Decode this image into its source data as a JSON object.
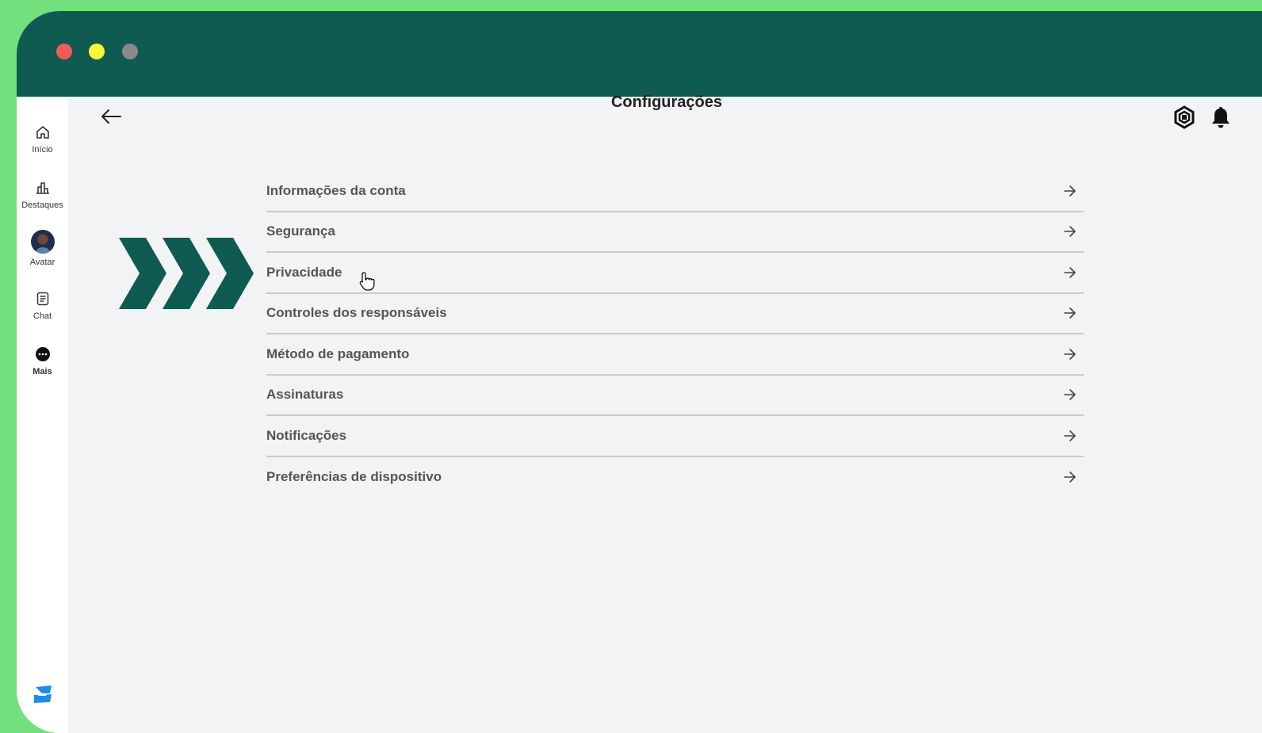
{
  "window": {
    "controls": [
      "close",
      "minimize",
      "maximize"
    ]
  },
  "sidebar": {
    "items": [
      {
        "label": "Início",
        "icon": "home-icon"
      },
      {
        "label": "Destaques",
        "icon": "chart-icon"
      },
      {
        "label": "Avatar",
        "icon": "avatar-icon"
      },
      {
        "label": "Chat",
        "icon": "chat-icon"
      },
      {
        "label": "Mais",
        "icon": "more-icon"
      }
    ],
    "logo": "roblox-logo-icon"
  },
  "header": {
    "title": "Configurações",
    "back_icon": "back-arrow-icon",
    "right_icons": [
      "robux-icon",
      "bell-icon"
    ]
  },
  "settings": {
    "items": [
      {
        "label": "Informações da conta"
      },
      {
        "label": "Segurança"
      },
      {
        "label": "Privacidade"
      },
      {
        "label": "Controles dos responsáveis"
      },
      {
        "label": "Método de pagamento"
      },
      {
        "label": "Assinaturas"
      },
      {
        "label": "Notificações"
      },
      {
        "label": "Preferências de dispositivo"
      }
    ]
  },
  "colors": {
    "background": "#72e07d",
    "titlebar": "#0f5a51",
    "content_bg": "#f2f3f4",
    "chevron": "#0f5a51"
  }
}
